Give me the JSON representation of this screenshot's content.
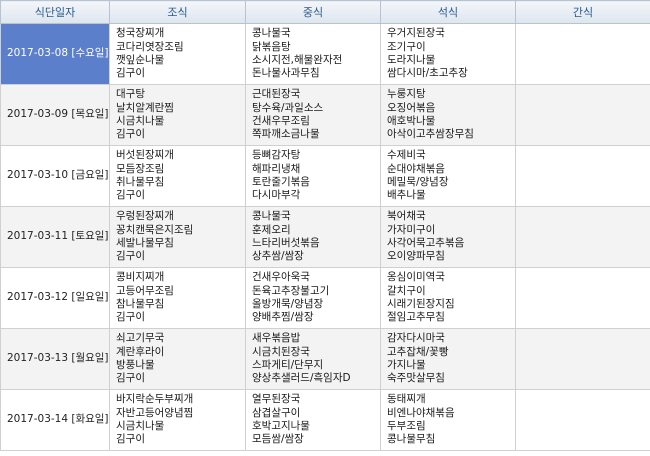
{
  "headers": [
    "식단일자",
    "조식",
    "중식",
    "석식",
    "간식"
  ],
  "days": [
    {
      "date": "2017-03-08 [수요일]",
      "selected": true,
      "breakfast": [
        "청국장찌개",
        "코다리엿장조림",
        "깻잎순나물",
        "김구이"
      ],
      "lunch": [
        "콩나물국",
        "닭볶음탕",
        "소시지전,해물완자전",
        "돈나물사과무침"
      ],
      "dinner": [
        "우거지된장국",
        "조기구이",
        "도라지나물",
        "쌈다시마/초고추장"
      ],
      "snack": []
    },
    {
      "date": "2017-03-09 [목요일]",
      "selected": false,
      "breakfast": [
        "대구탕",
        "날치알계란찜",
        "시금치나물",
        "김구이"
      ],
      "lunch": [
        "근대된장국",
        "탕수육/과일소스",
        "건새우무조림",
        "쪽파깨소금나물"
      ],
      "dinner": [
        "누룽지탕",
        "오징어볶음",
        "애호박나물",
        "아삭이고추쌈장무침"
      ],
      "snack": []
    },
    {
      "date": "2017-03-10 [금요일]",
      "selected": false,
      "breakfast": [
        "버섯된장찌개",
        "모듬장조림",
        "취나물무침",
        "김구이"
      ],
      "lunch": [
        "등뼈감자탕",
        "해파리냉채",
        "토란줄기볶음",
        "다시마부각"
      ],
      "dinner": [
        "수제비국",
        "순대야채볶음",
        "메밀묵/양념장",
        "배추나물"
      ],
      "snack": []
    },
    {
      "date": "2017-03-11 [토요일]",
      "selected": false,
      "breakfast": [
        "우렁된장찌개",
        "꽁치캔묵은지조림",
        "세발나물무침",
        "김구이"
      ],
      "lunch": [
        "콩나물국",
        "훈제오리",
        "느타리버섯볶음",
        "상추쌈/쌈장"
      ],
      "dinner": [
        "북어채국",
        "가자미구이",
        "사각어묵고추볶음",
        "오이양파무침"
      ],
      "snack": []
    },
    {
      "date": "2017-03-12 [일요일]",
      "selected": false,
      "breakfast": [
        "콩비지찌개",
        "고등어무조림",
        "참나물무침",
        "김구이"
      ],
      "lunch": [
        "건새우아욱국",
        "돈육고추장불고기",
        "올방개묵/양념장",
        "양배추찜/쌈장"
      ],
      "dinner": [
        "옹심이미역국",
        "갈치구이",
        "시래기된장지짐",
        "절임고추무침"
      ],
      "snack": []
    },
    {
      "date": "2017-03-13 [월요일]",
      "selected": false,
      "breakfast": [
        "쇠고기무국",
        "계란후라이",
        "방풍나물",
        "김구이"
      ],
      "lunch": [
        "새우볶음밥",
        "시금치된장국",
        "스파게티/단무지",
        "양상추샐러드/흑임자D"
      ],
      "dinner": [
        "감자다시마국",
        "고추잡채/꽃빵",
        "가지나물",
        "숙주맛살무침"
      ],
      "snack": []
    },
    {
      "date": "2017-03-14 [화요일]",
      "selected": false,
      "breakfast": [
        "바지락순두부찌개",
        "자반고등어양념찜",
        "시금치나물",
        "김구이"
      ],
      "lunch": [
        "열무된장국",
        "삼겹살구이",
        "호박고지나물",
        "모듬쌈/쌈장"
      ],
      "dinner": [
        "동태찌개",
        "비엔나야채볶음",
        "두부조림",
        "콩나물무침"
      ],
      "snack": []
    }
  ]
}
